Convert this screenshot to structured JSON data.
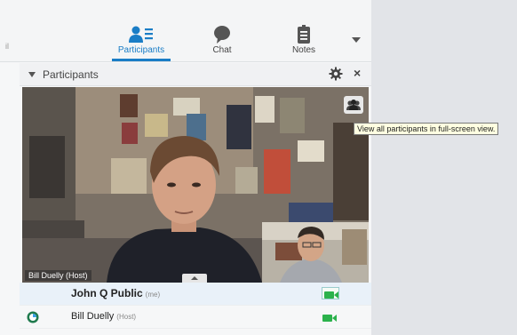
{
  "toolbar": {
    "tabs": [
      {
        "label": "Participants",
        "icon": "participants-icon",
        "active": true
      },
      {
        "label": "Chat",
        "icon": "chat-bubble-icon",
        "active": false
      },
      {
        "label": "Notes",
        "icon": "notes-icon",
        "active": false
      }
    ],
    "left_mark": "il",
    "more_icon": "chevron-down-icon",
    "active_color": "#1a7dc6"
  },
  "panel": {
    "title": "Participants",
    "settings_icon": "gear-icon",
    "close_icon": "close-icon",
    "close_glyph": "×"
  },
  "video": {
    "main_speaker_label": "Bill Duelly (Host)",
    "fullscreen_icon": "group-icon",
    "tooltip": "View all participants in full-screen view."
  },
  "participants": [
    {
      "name": "John Q Public",
      "tag": "(me)",
      "camera": "video-camera-icon",
      "status": null
    },
    {
      "name": "Bill Duelly",
      "tag": "(Host)",
      "camera": "video-camera-icon",
      "status": "presenter-status-icon"
    }
  ],
  "colors": {
    "camera_on": "#2bb24c",
    "right_pane": "#e2e4e8"
  }
}
